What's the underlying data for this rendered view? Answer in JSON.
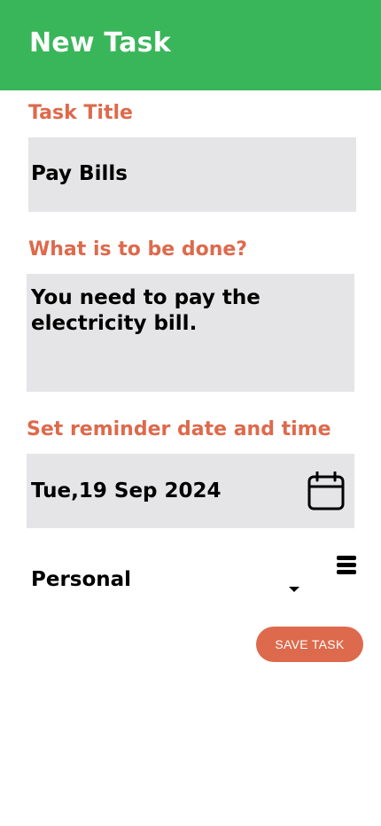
{
  "app_bar": {
    "title": "New Task",
    "color": "#3ab65a"
  },
  "form": {
    "title_label": "Task Title",
    "title_value": "Pay Bills",
    "description_label": "What is to be done?",
    "description_value": "You need to pay the electricity bill.",
    "reminder_label": "Set reminder date and time",
    "reminder_value": "Tue,19 Sep 2024",
    "category_value": "Personal",
    "save_label": "SAVE TASK"
  },
  "icons": {
    "calendar": "calendar-icon",
    "dropdown": "caret-down-icon",
    "menu": "menu-icon"
  },
  "colors": {
    "accent": "#dd6a4c",
    "field_bg": "#e5e5e7"
  }
}
